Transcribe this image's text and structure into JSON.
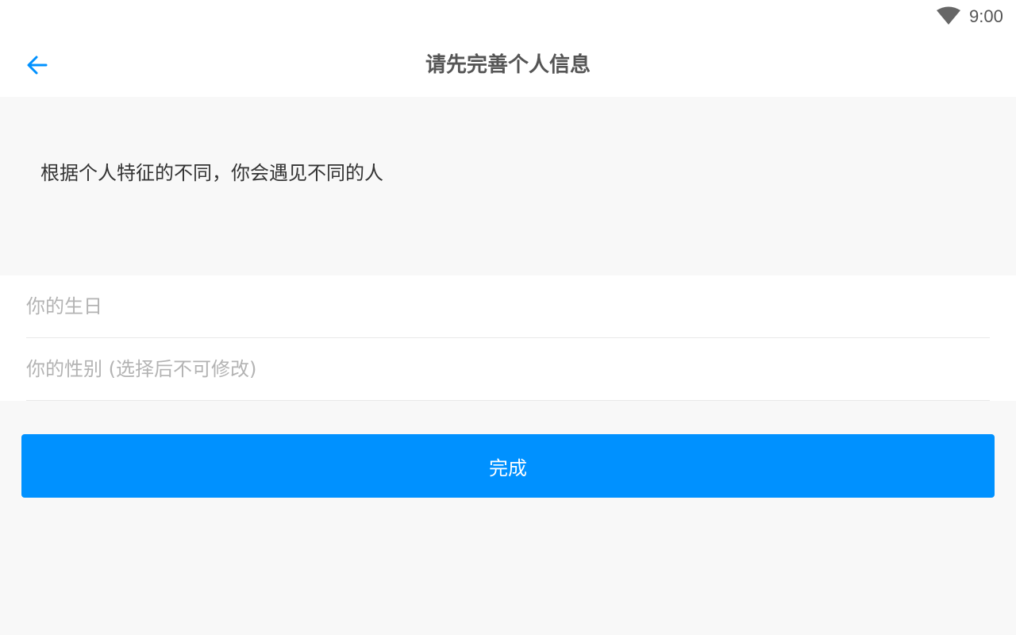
{
  "status_bar": {
    "icon": "wifi-icon",
    "time": "9:00"
  },
  "header": {
    "back_icon": "arrow-left-icon",
    "title": "请先完善个人信息"
  },
  "intro": {
    "text": "根据个人特征的不同，你会遇见不同的人"
  },
  "form": {
    "birthday_placeholder": "你的生日",
    "gender_placeholder": "你的性别 (选择后不可修改)"
  },
  "actions": {
    "done_label": "完成"
  },
  "colors": {
    "accent": "#0091ff",
    "background": "#f8f8f8",
    "title_text": "#555555",
    "placeholder_text": "#b3b3b3"
  }
}
